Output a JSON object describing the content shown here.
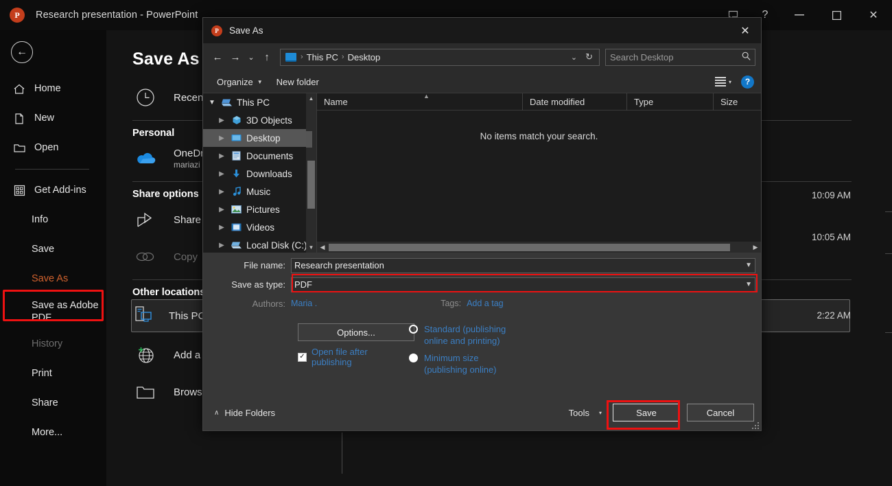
{
  "app": {
    "title": "Research presentation  -  PowerPoint",
    "logo_letter": "P",
    "window_controls": {
      "comment": "comment-icon",
      "help": "?",
      "minimize": "—",
      "restore": "☐",
      "close": "✕"
    }
  },
  "backstage": {
    "back_label": "←",
    "nav_items": [
      {
        "label": "Home",
        "icon": "home-icon"
      },
      {
        "label": "New",
        "icon": "new-document-icon"
      },
      {
        "label": "Open",
        "icon": "open-folder-icon"
      },
      {
        "label": "Get Add-ins",
        "icon": "addins-icon"
      },
      {
        "label": "Info",
        "icon": ""
      },
      {
        "label": "Save",
        "icon": ""
      },
      {
        "label": "Save As",
        "icon": ""
      },
      {
        "label": "Save as Adobe PDF",
        "icon": ""
      },
      {
        "label": "History",
        "icon": ""
      },
      {
        "label": "Print",
        "icon": ""
      },
      {
        "label": "Share",
        "icon": ""
      },
      {
        "label": "More...",
        "icon": ""
      }
    ],
    "active_item": "Save As",
    "page_title": "Save As",
    "recent_label": "Recent",
    "personal_header": "Personal",
    "onedrive_label": "OneDrive",
    "onedrive_sub": "mariazi",
    "share_options_header": "Share options",
    "share_label": "Share",
    "copy_label": "Copy",
    "other_locations_header": "Other locations",
    "this_pc_label": "This PC",
    "add_place_label": "Add a",
    "browse_label": "Browse",
    "timestamps": [
      "10:09 AM",
      "10:05 AM",
      "2:22 AM"
    ]
  },
  "dialog": {
    "title": "Save As",
    "close_label": "✕",
    "nav": {
      "back": "←",
      "forward": "→",
      "recent_chevron": "⌄",
      "up": "↑",
      "breadcrumbs": [
        "This PC",
        "Desktop"
      ],
      "breadcrumb_separator": "›",
      "address_chevron": "⌄",
      "refresh": "↻"
    },
    "search": {
      "placeholder": "Search Desktop",
      "icon": "search-icon"
    },
    "toolbar": {
      "organize": "Organize",
      "new_folder": "New folder",
      "view_icon": "view-layout-icon",
      "view_caret": "▾",
      "help": "?"
    },
    "tree": [
      {
        "label": "This PC",
        "indent": 0,
        "expanded": true,
        "icon": "pc-icon",
        "selected": false
      },
      {
        "label": "3D Objects",
        "indent": 1,
        "expanded": false,
        "icon": "cube-icon",
        "selected": false
      },
      {
        "label": "Desktop",
        "indent": 1,
        "expanded": false,
        "icon": "desktop-icon",
        "selected": true
      },
      {
        "label": "Documents",
        "indent": 1,
        "expanded": false,
        "icon": "documents-icon",
        "selected": false
      },
      {
        "label": "Downloads",
        "indent": 1,
        "expanded": false,
        "icon": "download-icon",
        "selected": false
      },
      {
        "label": "Music",
        "indent": 1,
        "expanded": false,
        "icon": "music-icon",
        "selected": false
      },
      {
        "label": "Pictures",
        "indent": 1,
        "expanded": false,
        "icon": "pictures-icon",
        "selected": false
      },
      {
        "label": "Videos",
        "indent": 1,
        "expanded": false,
        "icon": "videos-icon",
        "selected": false
      },
      {
        "label": "Local Disk (C:)",
        "indent": 1,
        "expanded": false,
        "icon": "disk-icon",
        "selected": false
      }
    ],
    "columns": [
      "Name",
      "Date modified",
      "Type",
      "Size"
    ],
    "empty_message": "No items match your search.",
    "form": {
      "file_name_label": "File name:",
      "file_name_value": "Research presentation",
      "save_as_type_label": "Save as type:",
      "save_as_type_value": "PDF",
      "authors_label": "Authors:",
      "authors_value": "Maria .",
      "tags_label": "Tags:",
      "tags_value": "Add a tag",
      "options_button": "Options...",
      "open_after_publishing": "Open file after publishing",
      "open_after_publishing_checked": true,
      "optimize": [
        {
          "label": "Standard (publishing online and printing)",
          "line1": "Standard (publishing",
          "line2": "online and printing)",
          "selected": false
        },
        {
          "label": "Minimum size (publishing online)",
          "line1": "Minimum size",
          "line2": "(publishing online)",
          "selected": true
        }
      ]
    },
    "footer": {
      "hide_folders": "Hide Folders",
      "hide_folders_caret": "∧",
      "tools": "Tools",
      "tools_caret": "▾",
      "save": "Save",
      "cancel": "Cancel"
    }
  },
  "highlights": {
    "color": "#ee1111",
    "targets": [
      "Save As sidebar item",
      "Save as type field",
      "Save button"
    ]
  }
}
